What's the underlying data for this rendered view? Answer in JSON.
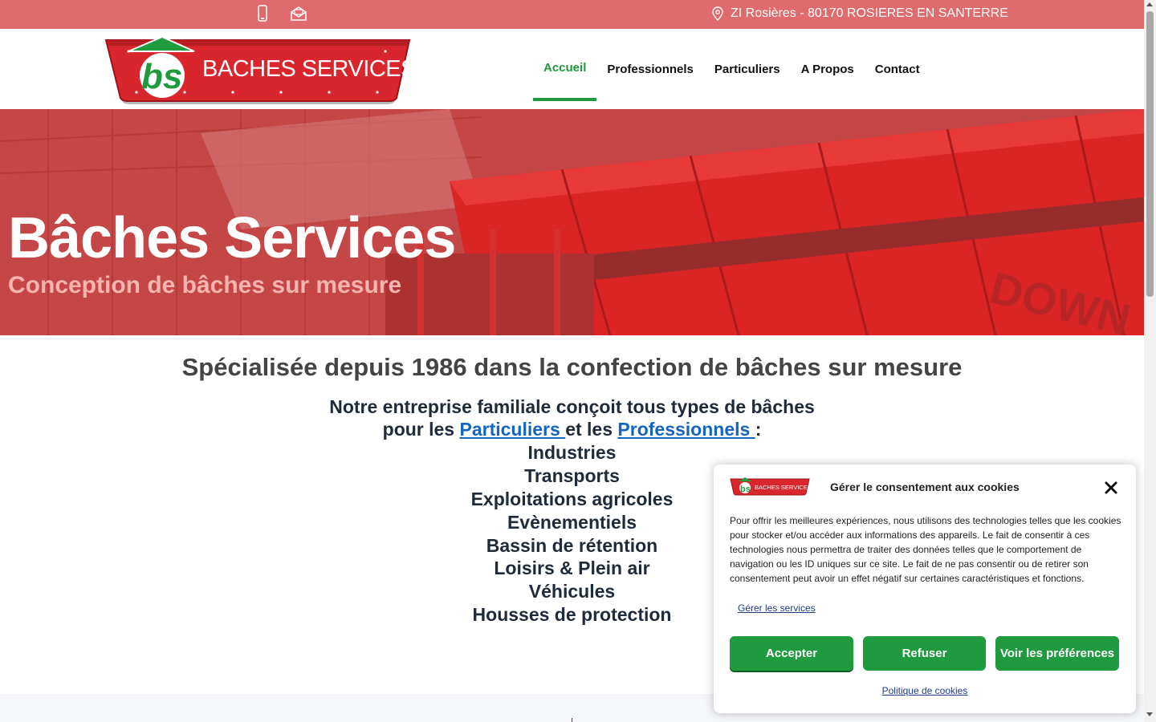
{
  "topbar": {
    "phone_icon": "phone-icon",
    "mail_icon": "mail-icon",
    "location_icon": "location-pin-icon",
    "address": "ZI Rosières - 80170 ROSIERES EN SANTERRE",
    "background": "#e06b6f"
  },
  "header": {
    "logo_text": "BACHES SERVICES",
    "logo_monogram": "bs",
    "nav": [
      {
        "label": "Accueil",
        "active": true
      },
      {
        "label": "Professionnels",
        "active": false
      },
      {
        "label": "Particuliers",
        "active": false
      },
      {
        "label": "A Propos",
        "active": false
      },
      {
        "label": "Contact",
        "active": false
      }
    ],
    "accent": "#1f9a3e"
  },
  "hero": {
    "title": "Bâches Services",
    "subtitle": "Conception de bâches sur mesure",
    "machine_text": "DOWN"
  },
  "main": {
    "headline": "Spécialisée depuis 1986 dans la confection de bâches sur mesure",
    "intro_line1": "Notre entreprise familiale conçoit tous types de bâches",
    "intro_pre": "pour les ",
    "intro_link1": "Particuliers ",
    "intro_mid": "et les ",
    "intro_link2": "Professionnels ",
    "intro_post": ":",
    "services": [
      "Industries",
      "Transports",
      "Exploitations agricoles",
      "Evènementiels",
      "Bassin de rétention",
      "Loisirs & Plein air",
      "Véhicules",
      "Housses de protection"
    ]
  },
  "cookie": {
    "logo_text": "BACHES SERVICES",
    "title": "Gérer le consentement aux cookies",
    "body": "Pour offrir les meilleures expériences, nous utilisons des technologies telles que les cookies pour stocker et/ou accéder aux informations des appareils. Le fait de consentir à ces technologies nous permettra de traiter des données telles que le comportement de navigation ou les ID uniques sur ce site. Le fait de ne pas consentir ou de retirer son consentement peut avoir un effet négatif sur certaines caractéristiques et fonctions.",
    "manage_services": "Gérer les services",
    "accept": "Accepter",
    "refuse": "Refuser",
    "preferences": "Voir les préférences",
    "policy": "Politique de cookies",
    "close_icon": "close-icon"
  }
}
